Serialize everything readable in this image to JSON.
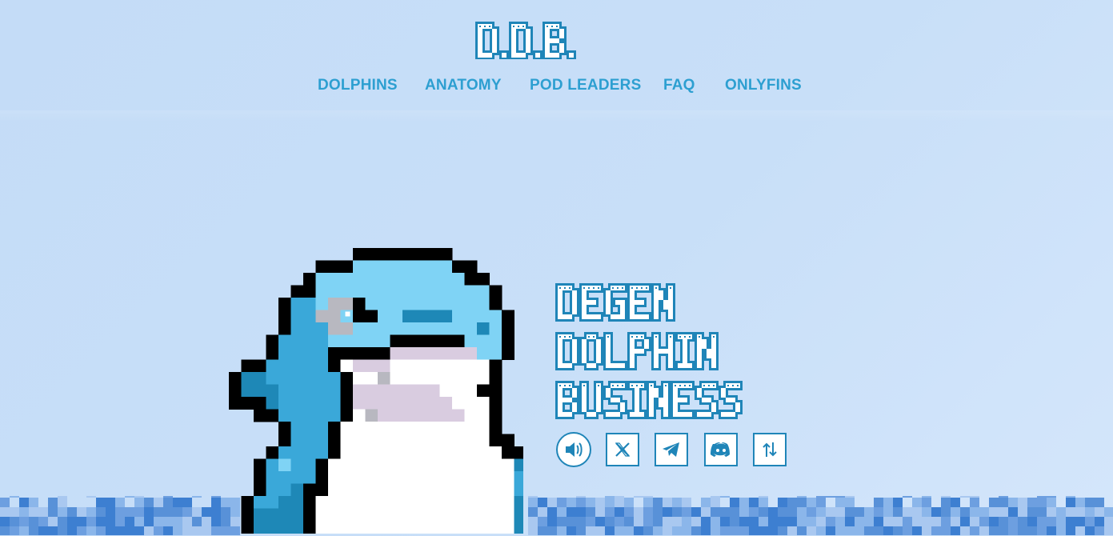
{
  "brand": {
    "logo_text": "D.D.B.",
    "colors": {
      "primary": "#2d9fd1",
      "outline": "#1f85b8",
      "background": "#c7ddf7",
      "water_dark": "#3d7fd1",
      "water_light": "#8bb6ea"
    }
  },
  "nav": {
    "items": [
      {
        "label": "DOLPHINS"
      },
      {
        "label": "ANATOMY"
      },
      {
        "label": "POD LEADERS"
      },
      {
        "label": "FAQ"
      },
      {
        "label": "ONLYFINS"
      }
    ]
  },
  "hero": {
    "title_lines": [
      "DEGEN",
      "DOLPHIN",
      "BUSINESS"
    ],
    "image": {
      "alt": "pixel dolphin mascot"
    }
  },
  "social": [
    {
      "icon": "speaker-icon",
      "label": "Sound"
    },
    {
      "icon": "x-icon",
      "label": "X"
    },
    {
      "icon": "telegram-icon",
      "label": "Telegram"
    },
    {
      "icon": "discord-icon",
      "label": "Discord"
    },
    {
      "icon": "dex-icon",
      "label": "Chart"
    }
  ]
}
